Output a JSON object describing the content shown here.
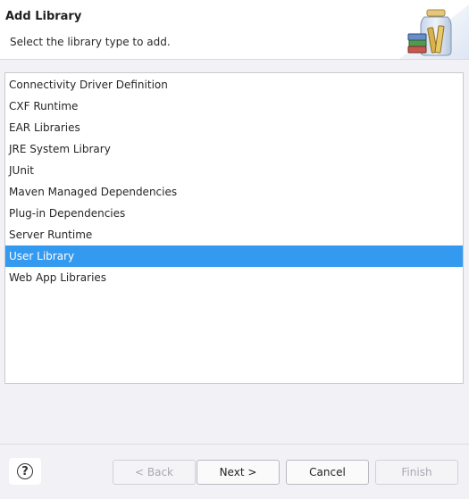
{
  "dialog": {
    "title": "Add Library",
    "description": "Select the library type to add.",
    "banner_icon": "library-jar-books-icon"
  },
  "library_types": [
    {
      "label": "Connectivity Driver Definition",
      "selected": false
    },
    {
      "label": "CXF Runtime",
      "selected": false
    },
    {
      "label": "EAR Libraries",
      "selected": false
    },
    {
      "label": "JRE System Library",
      "selected": false
    },
    {
      "label": "JUnit",
      "selected": false
    },
    {
      "label": "Maven Managed Dependencies",
      "selected": false
    },
    {
      "label": "Plug-in Dependencies",
      "selected": false
    },
    {
      "label": "Server Runtime",
      "selected": false
    },
    {
      "label": "User Library",
      "selected": true
    },
    {
      "label": "Web App Libraries",
      "selected": false
    }
  ],
  "buttons": {
    "help_label": "?",
    "back_label": "< Back",
    "next_label": "Next >",
    "cancel_label": "Cancel",
    "finish_label": "Finish",
    "back_enabled": false,
    "finish_enabled": false
  },
  "colors": {
    "selection": "#339af0",
    "background": "#f2f2f6"
  }
}
